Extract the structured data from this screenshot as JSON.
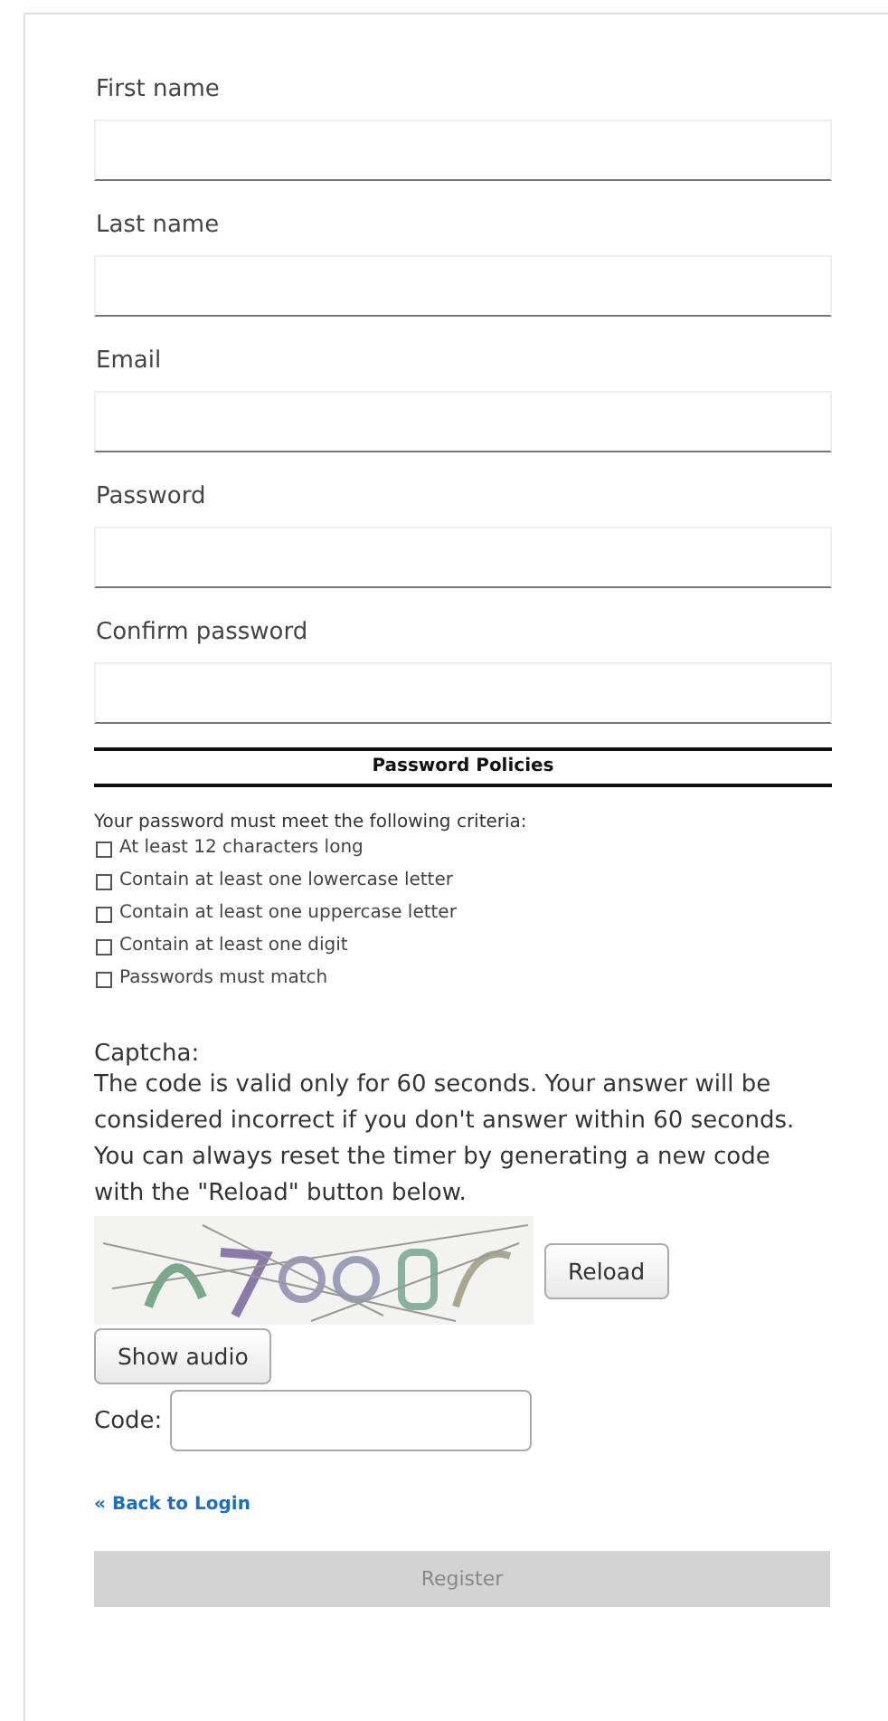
{
  "fields": [
    {
      "label": "First name"
    },
    {
      "label": "Last name"
    },
    {
      "label": "Email"
    },
    {
      "label": "Password"
    },
    {
      "label": "Confirm password"
    }
  ],
  "policies": {
    "title": "Password Policies",
    "intro": "Your password must meet the following criteria:",
    "criteria": [
      {
        "text": "At least 12 characters long",
        "checked": false
      },
      {
        "text": "Contain at least one lowercase letter",
        "checked": false
      },
      {
        "text": "Contain at least one uppercase letter",
        "checked": false
      },
      {
        "text": "Contain at least one digit",
        "checked": false
      },
      {
        "text": "Passwords must match",
        "checked": false
      }
    ]
  },
  "captcha": {
    "label": "Captcha:",
    "info": "The code is valid only for 60 seconds. Your answer will be considered incorrect if you don't answer within 60 seconds. You can always reset the timer by generating a new code with the \"Reload\" button below.",
    "reload": "Reload",
    "audio": "Show audio",
    "code_label": "Code:"
  },
  "back_link": "« Back to Login",
  "register": {
    "label": "Register",
    "disabled": true
  }
}
